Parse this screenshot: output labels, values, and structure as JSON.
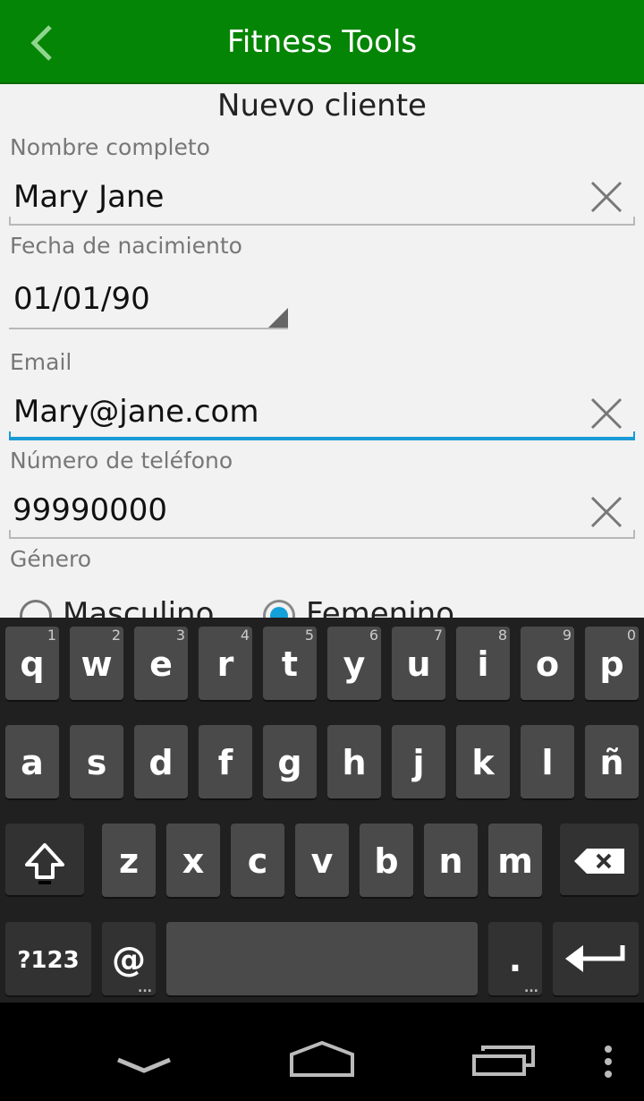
{
  "app": {
    "title": "Fitness Tools"
  },
  "form": {
    "heading": "Nuevo cliente",
    "name": {
      "label": "Nombre completo",
      "value": "Mary Jane"
    },
    "birthdate": {
      "label": "Fecha de nacimiento",
      "value": "01/01/90"
    },
    "email": {
      "label": "Email",
      "value": "Mary@jane.com"
    },
    "phone": {
      "label": "Número de teléfono",
      "value": "99990000"
    },
    "gender": {
      "label": "Género",
      "options": [
        "Masculino",
        "Femenino"
      ],
      "selected": "Femenino"
    }
  },
  "keyboard": {
    "row1": [
      {
        "k": "q",
        "h": "1"
      },
      {
        "k": "w",
        "h": "2"
      },
      {
        "k": "e",
        "h": "3"
      },
      {
        "k": "r",
        "h": "4"
      },
      {
        "k": "t",
        "h": "5"
      },
      {
        "k": "y",
        "h": "6"
      },
      {
        "k": "u",
        "h": "7"
      },
      {
        "k": "i",
        "h": "8"
      },
      {
        "k": "o",
        "h": "9"
      },
      {
        "k": "p",
        "h": "0"
      }
    ],
    "row2": [
      "a",
      "s",
      "d",
      "f",
      "g",
      "h",
      "j",
      "k",
      "l",
      "ñ"
    ],
    "row3": [
      "z",
      "x",
      "c",
      "v",
      "b",
      "n",
      "m"
    ],
    "symbols_key": "?123",
    "at_key": "@",
    "period_key": "."
  },
  "icons": {
    "back": "chevron-left-icon",
    "clear": "close-icon",
    "shift": "shift-arrow-icon",
    "backspace": "backspace-icon",
    "enter": "enter-arrow-icon",
    "nav_back": "chevron-down-icon",
    "nav_home": "home-icon",
    "nav_recents": "recent-apps-icon",
    "nav_menu": "overflow-menu-icon"
  },
  "colors": {
    "appbar": "#058505",
    "focus": "#1a9ad6",
    "radio_selected": "#14a0d8"
  }
}
